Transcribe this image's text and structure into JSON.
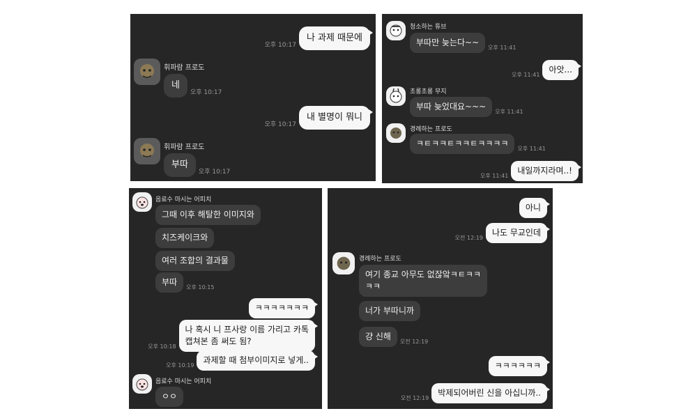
{
  "panels": {
    "p1": {
      "sender": "휘파람 프로도",
      "messages": [
        {
          "text": "나 과제 때문에",
          "time": "오후 10:17"
        },
        {
          "text": "네",
          "time": "오후 10:17"
        },
        {
          "text": "내 별명이 뭐니",
          "time": "오후 10:17"
        },
        {
          "text": "부따",
          "time": "오후 10:17"
        }
      ]
    },
    "p2": {
      "senders": [
        "청소하는 튜브",
        "초롱초롱 무지",
        "경례하는 프로도"
      ],
      "messages": [
        {
          "text": "부따만 늦는다~~",
          "time": "오후 11:41"
        },
        {
          "text": "아앗...",
          "time": "오후 11:41"
        },
        {
          "text": "부따 늦었대요~~~",
          "time": "오후 11:41"
        },
        {
          "text": "ㅋㅌㅋㅋㅌㅋㅋㅌㅋㅋㅋㅋ",
          "time": "오후 11:41"
        },
        {
          "text": "내일까지라며..!",
          "time": "오후 11:41"
        }
      ]
    },
    "p3": {
      "sender": "음료수 마시는 어피치",
      "messages": [
        {
          "text": "그때 이후 해탈한 이미지와"
        },
        {
          "text": "치즈케이크와"
        },
        {
          "text": "여러 조합의 결과물"
        },
        {
          "text": "부따",
          "time": "오후 10:15"
        },
        {
          "text": "ㅋㅋㅋㅋㅋㅋㅋ"
        },
        {
          "text": "나 혹시 니 프사랑 이름 가리고 카톡\n캡쳐본 좀 써도 됨?",
          "time": "오후 10:18"
        },
        {
          "text": "과제할 때 첨부이미지로 넣게..",
          "time": "오후 10:19"
        },
        {
          "text": "ㅇㅇ"
        }
      ]
    },
    "p4": {
      "sender": "경례하는 프로도",
      "messages": [
        {
          "text": "아니"
        },
        {
          "text": "나도 무교인데",
          "time": "오전 12:19"
        },
        {
          "text": "여기 종교 아무도 없잖앜ㅋㅌㅋㅋ\nㅋㅋ"
        },
        {
          "text": "너가 부따니까"
        },
        {
          "text": "걍 신해",
          "time": "오전 12:19"
        },
        {
          "text": "ㅋㅋㅋㅋㅋㅋ"
        },
        {
          "text": "박제되어버린 신을 아십니까..",
          "time": "오전 12:19"
        }
      ]
    }
  }
}
